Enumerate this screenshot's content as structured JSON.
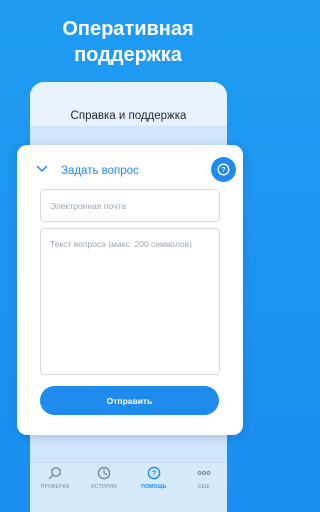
{
  "headline": {
    "line1": "Оперативная",
    "line2": "поддержка"
  },
  "phone": {
    "title": "Справка и поддержка"
  },
  "form": {
    "section_title": "Задать вопрос",
    "email_placeholder": "Электронная почта",
    "question_placeholder": "Текст вопроса (макс. 200 символов)",
    "submit_label": "Отправить"
  },
  "tabbar": {
    "items": [
      {
        "label": "ПРОВЕРКА",
        "icon": "search-icon",
        "active": false
      },
      {
        "label": "ИСТОРИЯ",
        "icon": "clock-icon",
        "active": false
      },
      {
        "label": "ПОМОЩЬ",
        "icon": "help-icon",
        "active": true
      },
      {
        "label": "ЕЩЕ",
        "icon": "more-icon",
        "active": false
      }
    ]
  },
  "colors": {
    "background": "#1a8ef0",
    "accent": "#1f8bec",
    "card": "#ffffff",
    "phone_body": "#cfe6fb"
  }
}
